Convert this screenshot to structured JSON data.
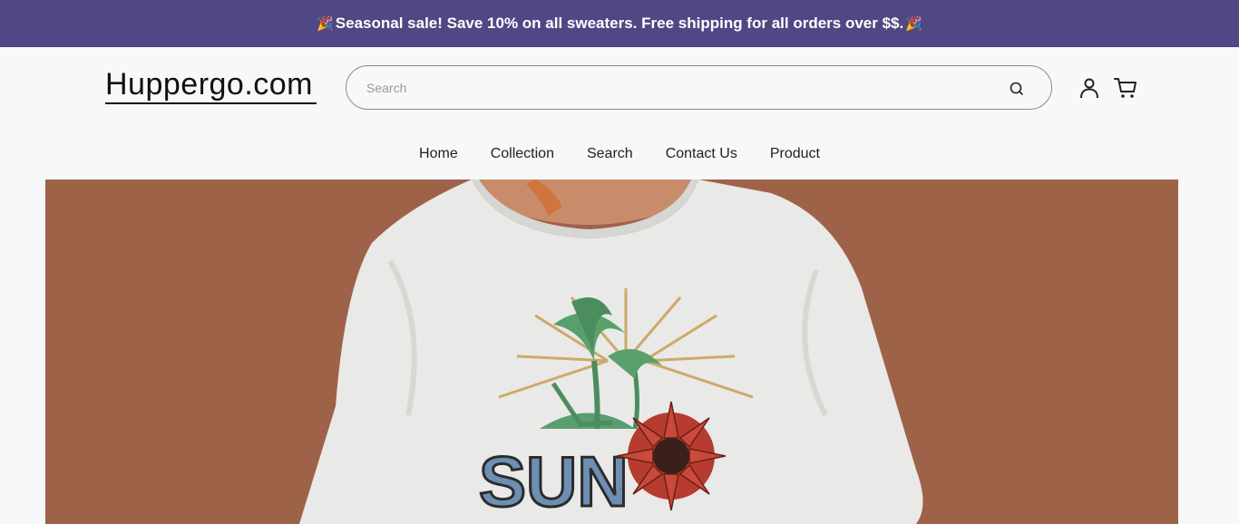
{
  "announcement": {
    "text": "Seasonal sale! Save 10% on all sweaters. Free shipping for all orders over $$.",
    "icon": "party-popper-icon"
  },
  "header": {
    "logo": "Huppergo.com",
    "search": {
      "placeholder": "Search",
      "value": ""
    },
    "icons": [
      "search-icon",
      "account-icon",
      "cart-icon"
    ]
  },
  "nav": {
    "items": [
      {
        "label": "Home"
      },
      {
        "label": "Collection"
      },
      {
        "label": "Search"
      },
      {
        "label": "Contact Us"
      },
      {
        "label": "Product"
      }
    ]
  },
  "hero": {
    "background": "#9e6249",
    "shirt_text": "SUN",
    "image_description_icon": "t-shirt-image"
  },
  "colors": {
    "announcement_bg": "#4f4884",
    "page_bg": "#f7f8fa"
  }
}
